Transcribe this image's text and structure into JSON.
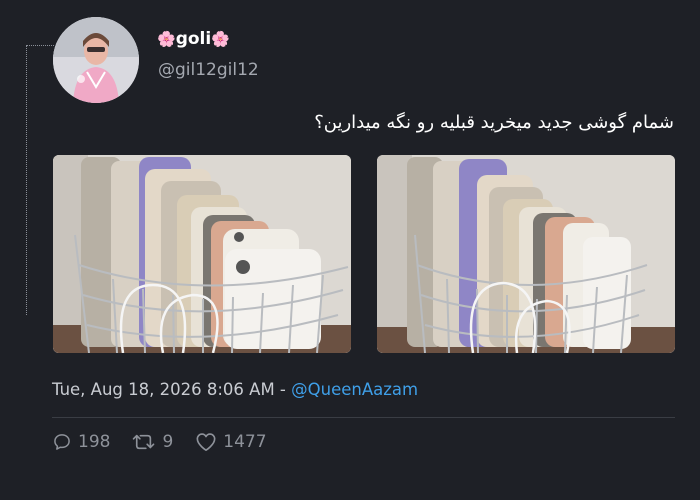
{
  "tweet": {
    "display_name": "goli",
    "name_emoji": "🌸",
    "handle": "@gil12gil12",
    "text": "شمام گوشی جدید میخرید قبلیه رو نگه میدارین؟",
    "timestamp": "Tue, Aug 18, 2026 8:06 AM",
    "separator": " - ",
    "mention": "@QueenAazam",
    "media_count": 2
  },
  "stats": {
    "replies": "198",
    "retweets": "9",
    "likes": "1477"
  },
  "icons": {
    "reply": "reply-icon",
    "retweet": "retweet-icon",
    "like": "heart-icon"
  },
  "colors": {
    "background": "#1e2026",
    "text": "#ffffff",
    "secondary": "#a4a8b0",
    "link": "#3f9fe8",
    "flower": "#ff8fb6"
  }
}
